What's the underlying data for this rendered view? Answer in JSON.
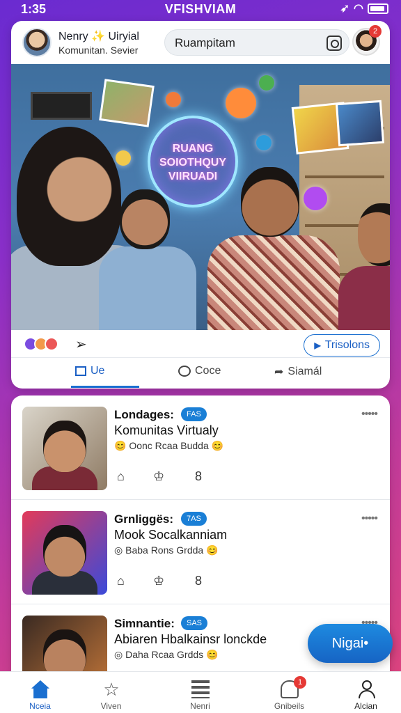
{
  "status": {
    "time": "1:35",
    "carrier": "VFISHVIAM"
  },
  "header": {
    "name": "Nenry ✨ Uiryial",
    "subtitle": "Komunitan. Sevier",
    "search_placeholder": "Ruampitam",
    "notification_count": "2"
  },
  "hero": {
    "orb_line1": "RUANG",
    "orb_line2": "SOIOTHQUY",
    "orb_line3": "VIIRUADI"
  },
  "post_actions": {
    "transmit_label": "Trisolons"
  },
  "tabs": [
    {
      "label": "Ue"
    },
    {
      "label": "Coce"
    },
    {
      "label": "Siamál"
    }
  ],
  "feed": [
    {
      "title": "Londages:",
      "badge": "FAS",
      "subtitle": "Komunitas Virtualy",
      "meta": "😊 Oonc Rcaa Budda 😊",
      "dots": "•••••"
    },
    {
      "title": "Grnliggës:",
      "badge": "7AS",
      "subtitle": "Mook Socalkanniam",
      "meta": "◎ Baba Rons Grdda 😊",
      "dots": "•••••"
    },
    {
      "title": "Simnantie:",
      "badge": "SAS",
      "subtitle": "Abiaren Hbalkainsr lonckde",
      "meta": "◎ Daha Rcaa Grdds 😊",
      "dots": "•••••"
    }
  ],
  "fab": {
    "label": "Nigai•"
  },
  "nav": [
    {
      "label": "Nceia",
      "icon": "home-icon"
    },
    {
      "label": "Viven",
      "icon": "star-icon"
    },
    {
      "label": "Nenri",
      "icon": "list-icon"
    },
    {
      "label": "Gnibeils",
      "icon": "bell-icon",
      "badge": "1"
    },
    {
      "label": "Alcian",
      "icon": "user-icon"
    }
  ],
  "colors": {
    "accent": "#1a6fd0",
    "badge_red": "#e53935",
    "bg_gradient_start": "#6a2bd0",
    "bg_gradient_end": "#e0457a"
  }
}
